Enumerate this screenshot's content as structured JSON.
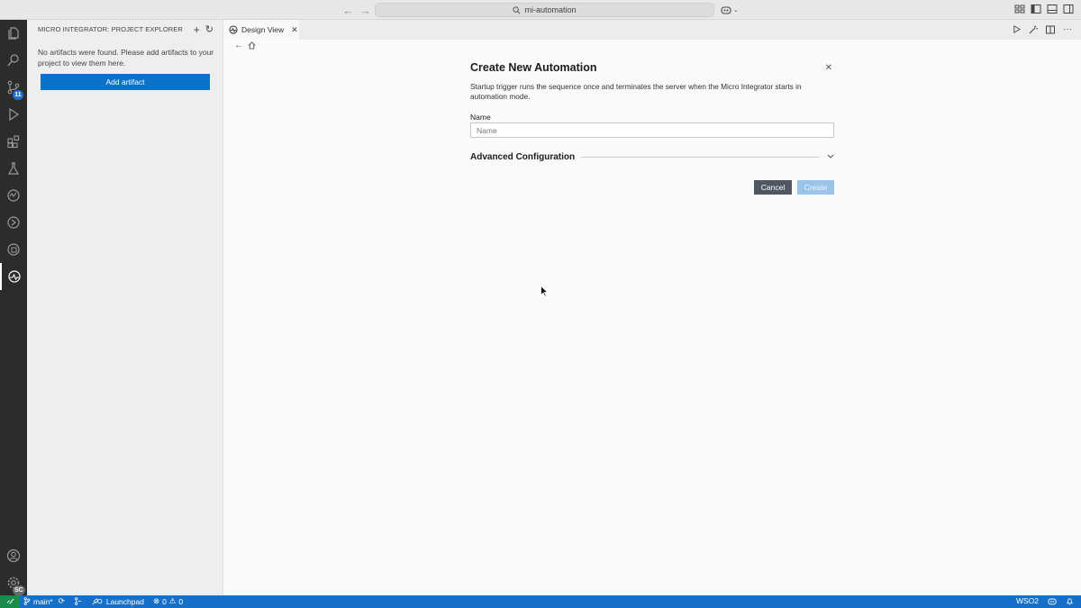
{
  "titlebar": {
    "search_text": "mi-automation"
  },
  "activitybar": {
    "scm_badge": "11",
    "manage_badge": "SC"
  },
  "sidebar": {
    "header": "MICRO INTEGRATOR: PROJECT EXPLORER",
    "empty_message": "No artifacts were found. Please add artifacts to your project to view them here.",
    "add_artifact_label": "Add artifact"
  },
  "tabs": [
    {
      "label": "Design View"
    }
  ],
  "dialog": {
    "title": "Create New Automation",
    "description": "Startup trigger runs the sequence once and terminates the server when the Micro Integrator starts in automation mode.",
    "name_label": "Name",
    "name_placeholder": "Name",
    "name_value": "",
    "advanced_label": "Advanced Configuration",
    "cancel_label": "Cancel",
    "create_label": "Create"
  },
  "statusbar": {
    "branch": "main*",
    "launchpad": "Launchpad",
    "errors": "0",
    "warnings": "0",
    "org": "WSO2"
  },
  "colors": {
    "primary_button": "#0b72c9",
    "statusbar": "#1670c9",
    "remote_indicator": "#1a8a4d",
    "cancel_button": "#4f5860",
    "create_button_disabled": "#9ac4ea"
  }
}
